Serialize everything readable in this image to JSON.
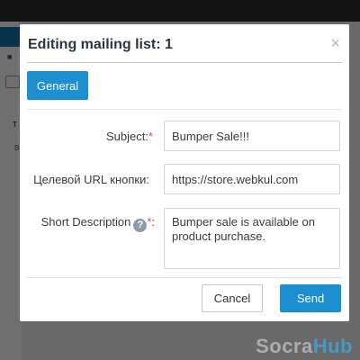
{
  "modal": {
    "title": "Editing mailing list: 1",
    "close_glyph": "×",
    "tabs": [
      {
        "label": "General",
        "active": true
      }
    ],
    "fields": {
      "subject": {
        "label": "Subject:",
        "required_mark": "*",
        "value": "Bumper Sale!!!"
      },
      "button_url": {
        "label": "Целевой URL кнопки:",
        "value": "https://store.webkul.com"
      },
      "short_description": {
        "label": "Short Description",
        "help_glyph": "?",
        "required_mark": "*",
        "label_suffix": ":",
        "value": "Bumper sale is available on product purchase."
      }
    },
    "buttons": {
      "cancel": "Cancel",
      "send": "Send"
    }
  },
  "watermark": {
    "part1": "Socra",
    "part2": "Hub"
  },
  "colors": {
    "primary": "#1c8fd1",
    "required": "#e04a4a",
    "title_text": "#2d3640"
  },
  "icons": {
    "close": "close-icon",
    "help": "help-icon"
  }
}
